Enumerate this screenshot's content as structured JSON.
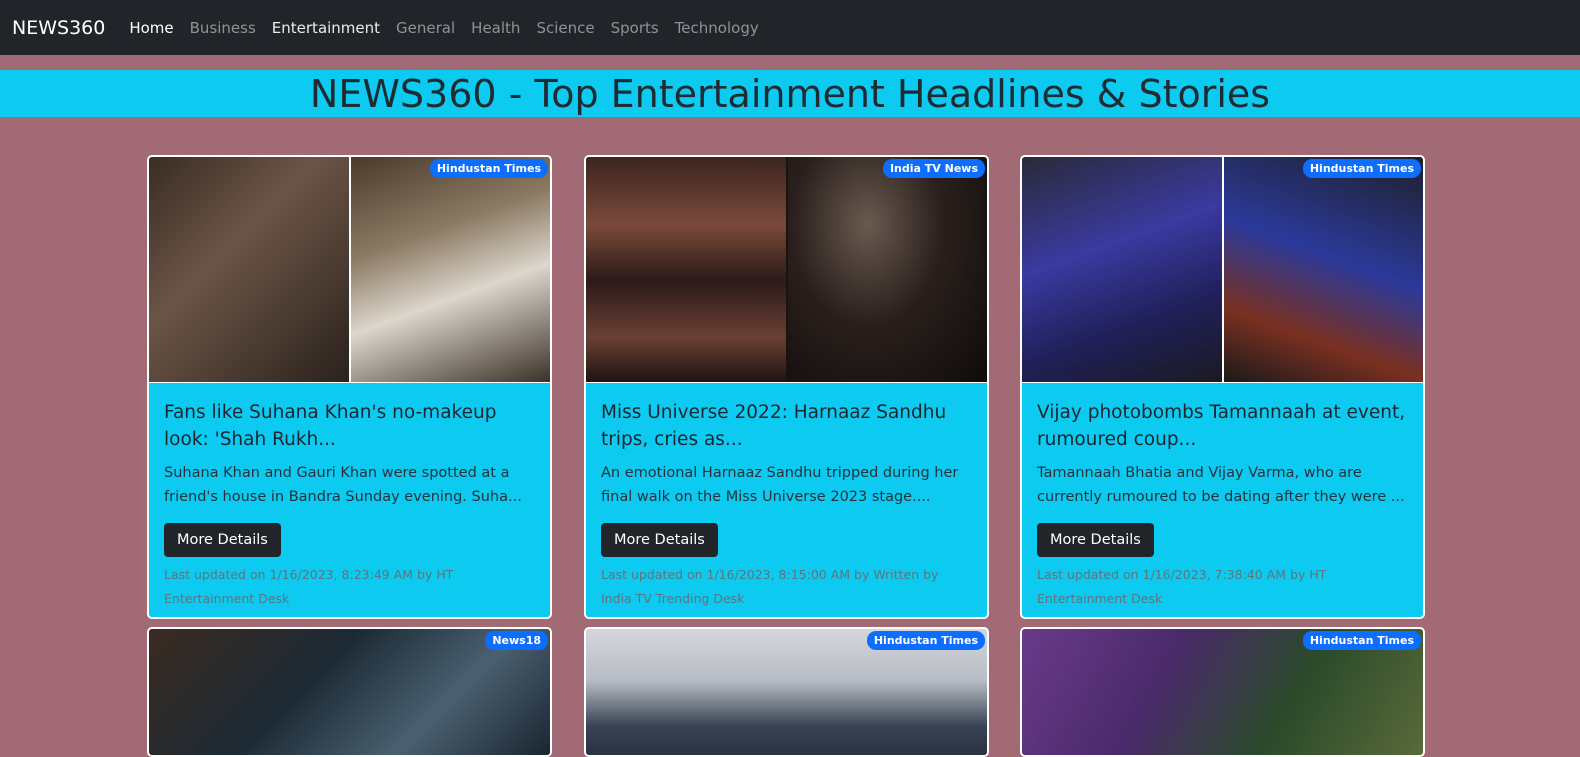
{
  "navbar": {
    "brand": "NEWS360",
    "links": [
      "Home",
      "Business",
      "Entertainment",
      "General",
      "Health",
      "Science",
      "Sports",
      "Technology"
    ]
  },
  "heading": "NEWS360 - Top Entertainment Headlines & Stories",
  "colors": {
    "navbar_bg": "#212529",
    "page_bg": "#a26a75",
    "accent_cyan": "#0dcaf0",
    "badge_blue": "#0d6efd"
  },
  "button_label": "More Details",
  "cards": [
    {
      "source": "Hindustan Times",
      "title": "Fans like Suhana Khan's no-makeup look: 'Shah Rukh...",
      "description": "Suhana Khan and Gauri Khan were spotted at a friend's house in Bandra Sunday evening. Suha...",
      "meta": "Last updated on 1/16/2023, 8:23:49 AM by HT Entertainment Desk"
    },
    {
      "source": "India TV News",
      "title": "Miss Universe 2022: Harnaaz Sandhu trips, cries as...",
      "description": "An emotional Harnaaz Sandhu tripped during her final walk on the Miss Universe 2023 stage....",
      "meta": "Last updated on 1/16/2023, 8:15:00 AM by Written by India TV Trending Desk"
    },
    {
      "source": "Hindustan Times",
      "title": "Vijay photobombs Tamannaah at event, rumoured coup...",
      "description": "Tamannaah Bhatia and Vijay Varma, who are currently rumoured to be dating after they were ...",
      "meta": "Last updated on 1/16/2023, 7:38:40 AM by HT Entertainment Desk"
    },
    {
      "source": "News18"
    },
    {
      "source": "Hindustan Times"
    },
    {
      "source": "Hindustan Times"
    }
  ]
}
